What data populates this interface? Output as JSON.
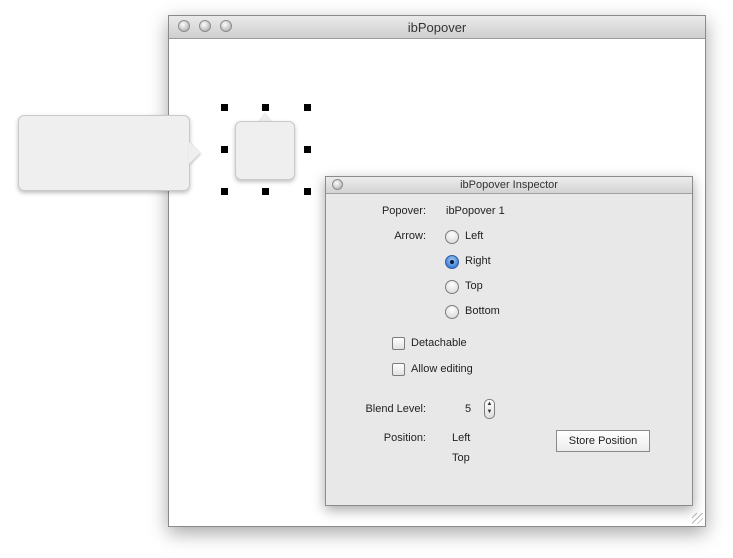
{
  "main_window": {
    "title": "ibPopover"
  },
  "inspector": {
    "title": "ibPopover Inspector",
    "popover_label": "Popover:",
    "popover_value": "ibPopover 1",
    "arrow_label": "Arrow:",
    "arrow_options": [
      {
        "label": "Left",
        "selected": false
      },
      {
        "label": "Right",
        "selected": true
      },
      {
        "label": "Top",
        "selected": false
      },
      {
        "label": "Bottom",
        "selected": false
      }
    ],
    "detachable_label": "Detachable",
    "detachable_checked": false,
    "allow_editing_label": "Allow editing",
    "allow_editing_checked": false,
    "blend_level_label": "Blend Level:",
    "blend_level_value": "5",
    "position_label": "Position:",
    "position_horizontal": "Left",
    "position_vertical": "Top",
    "store_position_label": "Store Position"
  },
  "colors": {
    "selected_radio": "#3b7fd8",
    "popover_fill": "#efefef",
    "panel_bg": "#e8e8e8"
  }
}
